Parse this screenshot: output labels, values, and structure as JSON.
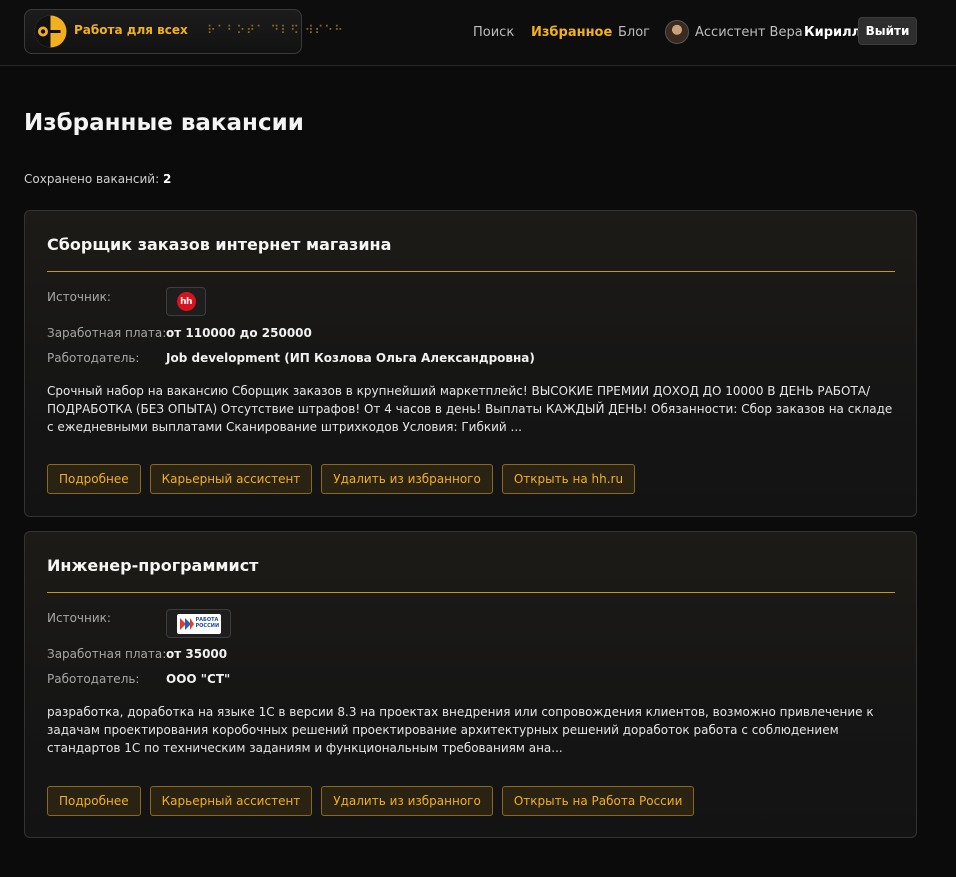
{
  "header": {
    "brand_name": "Работа для всех",
    "brand_braille": "⠗⠁⠃⠕⠞⠁ ⠙⠇⠫ ⠺⠎⠑⠓",
    "nav": {
      "search": "Поиск",
      "favorites": "Избранное",
      "blog": "Блог",
      "assistant": "Ассистент Вера"
    },
    "user_name": "Кирилл",
    "logout_label": "Выйти"
  },
  "page": {
    "title": "Избранные вакансии",
    "saved_label": "Сохранено вакансий:",
    "saved_count": "2"
  },
  "labels": {
    "source": "Источник:",
    "salary": "Заработная плата:",
    "employer": "Работодатель:"
  },
  "vacancies": [
    {
      "title": "Сборщик заказов интернет магазина",
      "source_icon": "hh-logo",
      "source_text": "hh",
      "salary": "от 110000 до 250000",
      "employer": "Job development (ИП Козлова Ольга Александровна)",
      "description": "Срочный набор на вакансию Сборщик заказов в крупнейший маркетплейс! ВЫСОКИЕ ПРЕМИИ ДОХОД ДО 10000 В ДЕНЬ РАБОТА/ПОДРАБОТКА (БЕЗ ОПЫТА) Отсутствие штрафов! От 4 часов в день! Выплаты КАЖДЫЙ ДЕНЬ! Обязанности: Сбор заказов на складе с ежедневными выплатами Сканирование штрихкодов Условия: Гибкий ...",
      "actions": {
        "details": "Подробнее",
        "assistant": "Карьерный ассистент",
        "remove": "Удалить из избранного",
        "open": "Открыть на hh.ru"
      }
    },
    {
      "title": "Инженер-программист",
      "source_icon": "rabota-rossii-logo",
      "source_text": "РАБОТА РОССИИ",
      "salary": "от 35000",
      "employer": "ООО \"СТ\"",
      "description": "разработка, доработка на языке 1С в версии 8.3 на проектах внедрения или сопровождения клиентов, возможно привлечение к задачам проектирования коробочных решений проектирование архитектурных решений доработок работа с соблюдением стандартов 1С по техническим заданиям и функциональным требованиям ана...",
      "actions": {
        "details": "Подробнее",
        "assistant": "Карьерный ассистент",
        "remove": "Удалить из избранного",
        "open": "Открыть на Работа России"
      }
    }
  ],
  "colors": {
    "accent": "#f2b01e",
    "background": "#0b0b0b",
    "hh_red": "#d7141e"
  }
}
